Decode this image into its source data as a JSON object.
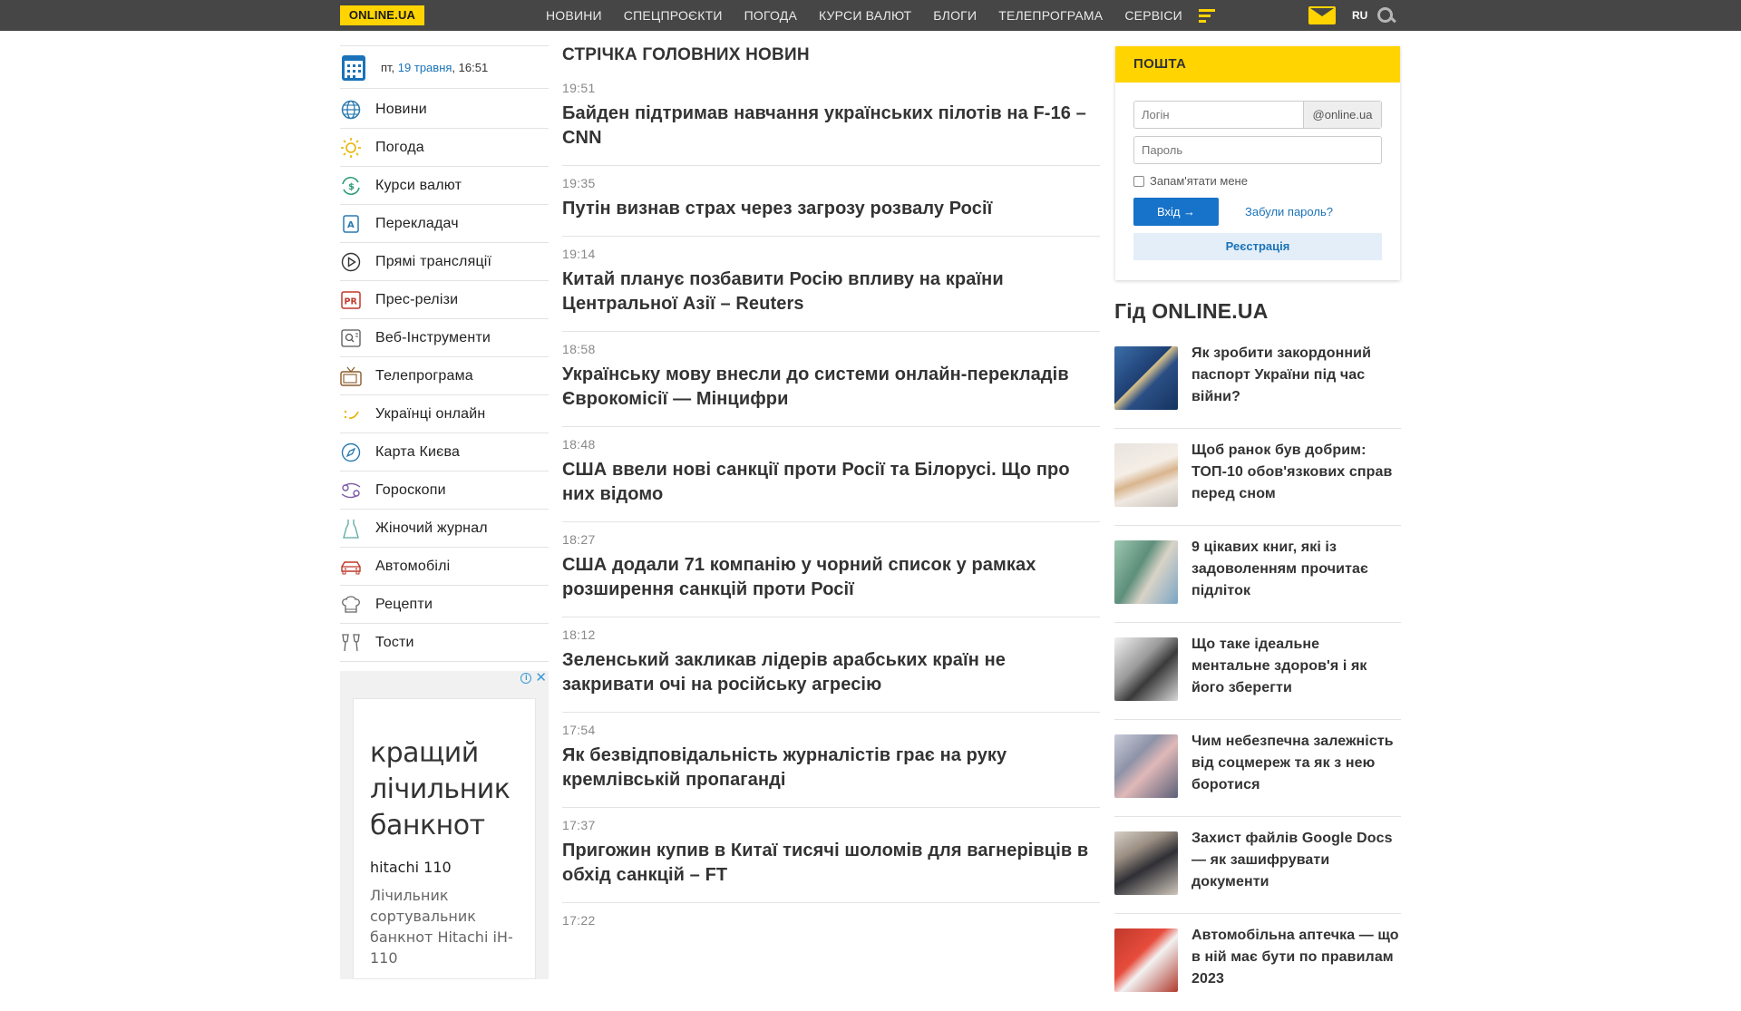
{
  "header": {
    "logo": "ONLINE.UA",
    "nav": [
      "НОВИНИ",
      "СПЕЦПРОЄКТИ",
      "ПОГОДА",
      "КУРСИ ВАЛЮТ",
      "БЛОГИ",
      "ТЕЛЕПРОГРАМА",
      "СЕРВІСИ"
    ],
    "lang": "RU"
  },
  "date": {
    "weekday": "пт,",
    "daymonth": "19 травня",
    "time": ", 16:51"
  },
  "sidebar": {
    "items": [
      {
        "label": "Новини",
        "icon": "globe-icon"
      },
      {
        "label": "Погода",
        "icon": "sun-icon"
      },
      {
        "label": "Курси валют",
        "icon": "currency-exchange-icon"
      },
      {
        "label": "Перекладач",
        "icon": "translate-icon"
      },
      {
        "label": "Прямі трансляції",
        "icon": "play-icon"
      },
      {
        "label": "Прес-релізи",
        "icon": "pr-icon"
      },
      {
        "label": "Веб-Інструменти",
        "icon": "web-tools-icon"
      },
      {
        "label": "Телепрограма",
        "icon": "tv-icon"
      },
      {
        "label": "Українці онлайн",
        "icon": "smile-icon"
      },
      {
        "label": "Карта Києва",
        "icon": "compass-icon"
      },
      {
        "label": "Гороскопи",
        "icon": "cancer-zodiac-icon"
      },
      {
        "label": "Жіночий журнал",
        "icon": "dress-icon"
      },
      {
        "label": "Автомобілі",
        "icon": "car-icon"
      },
      {
        "label": "Рецепти",
        "icon": "chef-hat-icon"
      },
      {
        "label": "Тости",
        "icon": "glasses-icon"
      }
    ]
  },
  "ad": {
    "headline": "кращий лічильник банкнот",
    "subtitle": "hitachi 110",
    "description": "Лічильник сортувальник банкнот Hitachi iH-110"
  },
  "feed": {
    "heading": "СТРІЧКА ГОЛОВНИХ НОВИН",
    "items": [
      {
        "time": "19:51",
        "title": "Байден підтримав навчання українських пілотів на F-16 – CNN"
      },
      {
        "time": "19:35",
        "title": "Путін визнав страх через загрозу розвалу Росії"
      },
      {
        "time": "19:14",
        "title": "Китай планує позбавити Росію впливу на країни Центральної Азії – Reuters"
      },
      {
        "time": "18:58",
        "title": "Українську мову внесли до системи онлайн-перекладів Єврокомісії — Мінцифри"
      },
      {
        "time": "18:48",
        "title": "США ввели нові санкції проти Росії та Білорусі. Що про них відомо"
      },
      {
        "time": "18:27",
        "title": "США додали 71 компанію у чорний список у рамках розширення санкцій проти Росії"
      },
      {
        "time": "18:12",
        "title": "Зеленський закликав лідерів арабських країн не закривати очі на російську агресію"
      },
      {
        "time": "17:54",
        "title": "Як безвідповідальність журналістів грає на руку кремлівській пропаганді"
      },
      {
        "time": "17:37",
        "title": "Пригожин купив в Китаї тисячі шоломів для вагнерівців в обхід санкцій – FT"
      },
      {
        "time": "17:22",
        "title": ""
      }
    ]
  },
  "mail": {
    "title": "ПОШТА",
    "login_placeholder": "Логін",
    "domain": "@online.ua",
    "password_placeholder": "Пароль",
    "remember": "Запам'ятати мене",
    "login_button": "Вхід →",
    "forgot": "Забули пароль?",
    "register": "Реєстрація"
  },
  "guide": {
    "title": "Гід ONLINE.UA",
    "items": [
      {
        "title": "Як зробити закордонний паспорт України під час війни?"
      },
      {
        "title": "Щоб ранок був добрим: ТОП-10 обов'язкових справ перед сном"
      },
      {
        "title": "9 цікавих книг, які із задоволенням прочитає підліток"
      },
      {
        "title": "Що таке ідеальне ментальне здоров'я і як його зберегти"
      },
      {
        "title": "Чим небезпечна залежність від соцмереж та як з нею боротися"
      },
      {
        "title": "Захист файлів Google Docs — як зашифрувати документи"
      },
      {
        "title": "Автомобільна аптечка — що в ній має бути по правилам 2023"
      }
    ]
  },
  "colors": {
    "accent": "#ffd400",
    "topbar": "#464646",
    "link": "#1a73b8",
    "button": "#1773c9"
  }
}
